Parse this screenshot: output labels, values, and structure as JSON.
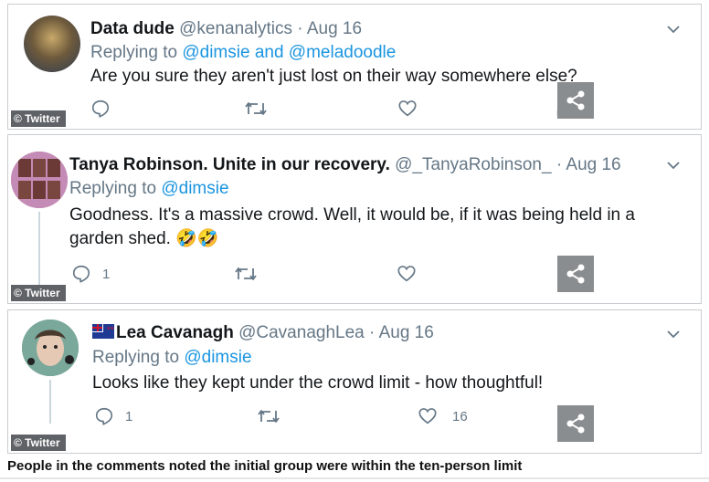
{
  "tweets": [
    {
      "name": "Data dude",
      "handle": "@kenanalytics",
      "date": "Aug 16",
      "replying_prefix": "Replying to",
      "replying_to": "@dimsie and @meladoodle",
      "text": "Are you sure they aren't just lost on their way somewhere else?",
      "reply_count": "",
      "retweet_count": "",
      "like_count": ""
    },
    {
      "name": "Tanya Robinson. Unite in our recovery.",
      "handle": "@_TanyaRobinson_",
      "date": "Aug 16",
      "replying_prefix": "Replying to",
      "replying_to": "@dimsie",
      "text_line1": "Goodness. It's a massive crowd. Well, it would be, if it was being held in a",
      "text_line2": "garden shed.",
      "emoji": "🤣🤣",
      "reply_count": "1",
      "retweet_count": "",
      "like_count": ""
    },
    {
      "name": "Lea Cavanagh",
      "handle": "@CavanaghLea",
      "date": "Aug 16",
      "replying_prefix": "Replying to",
      "replying_to": "@dimsie",
      "text": "Looks like they kept under the crowd limit - how thoughtful!",
      "reply_count": "1",
      "retweet_count": "",
      "like_count": "16"
    }
  ],
  "separator": "·",
  "source_tag": "© Twitter",
  "caption": "People in the comments noted the initial group were within the ten-person limit",
  "icons": {
    "caret": "chevron-down-icon",
    "reply": "reply-icon",
    "retweet": "retweet-icon",
    "like": "heart-icon",
    "share": "share-icon"
  },
  "colors": {
    "link": "#1b95e0",
    "muted": "#657786",
    "tag_bg": "#5f6266"
  }
}
